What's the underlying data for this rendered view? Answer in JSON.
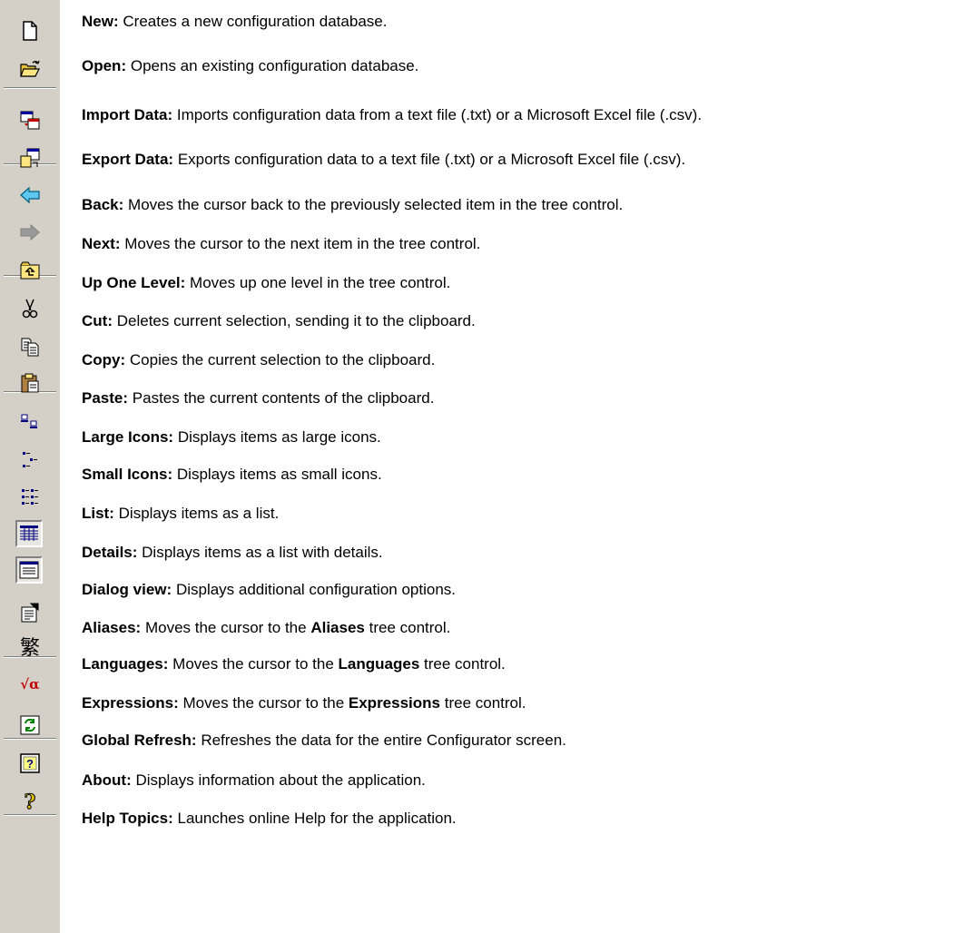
{
  "items": [
    {
      "name": "New",
      "icon": "new-document-icon",
      "desc": "Creates a new configuration database."
    },
    {
      "name": "Open",
      "icon": "open-folder-icon",
      "desc": "Opens an existing configuration database."
    },
    {
      "name": "Import Data",
      "icon": "import-data-icon",
      "desc": "Imports configuration data from a text file (.txt) or a Microsoft Excel file (.csv)."
    },
    {
      "name": "Export Data",
      "icon": "export-data-icon",
      "desc": "Exports configuration data to a text file (.txt) or a Microsoft Excel file (.csv)."
    },
    {
      "name": "Back",
      "icon": "back-arrow-icon",
      "desc": "Moves the cursor back to the previously selected item in the tree control."
    },
    {
      "name": "Next",
      "icon": "next-arrow-icon",
      "desc": "Moves the cursor to the next item in the tree control."
    },
    {
      "name": "Up One Level",
      "icon": "up-one-level-icon",
      "desc": "Moves up one level in the tree control."
    },
    {
      "name": "Cut",
      "icon": "scissors-icon",
      "desc": "Deletes current selection, sending it to the clipboard."
    },
    {
      "name": "Copy",
      "icon": "copy-icon",
      "desc": "Copies the current selection to the clipboard."
    },
    {
      "name": "Paste",
      "icon": "paste-icon",
      "desc": "Pastes the current contents of the clipboard."
    },
    {
      "name": "Large Icons",
      "icon": "large-icons-view-icon",
      "desc": "Displays items as large icons."
    },
    {
      "name": "Small Icons",
      "icon": "small-icons-view-icon",
      "desc": "Displays items as small icons."
    },
    {
      "name": "List",
      "icon": "list-view-icon",
      "desc": "Displays items as a list."
    },
    {
      "name": "Details",
      "icon": "details-view-icon",
      "desc": "Displays items as a list with details."
    },
    {
      "name": "Dialog view",
      "icon": "dialog-view-icon",
      "desc": "Displays additional configuration options."
    },
    {
      "name": "Aliases",
      "icon": "aliases-icon",
      "desc": "Moves the cursor to the",
      "bold_target": "Aliases",
      "tail": "tree control."
    },
    {
      "name": "Languages",
      "icon": "languages-icon",
      "desc": "Moves the cursor to the",
      "bold_target": "Languages",
      "tail": "tree control."
    },
    {
      "name": "Expressions",
      "icon": "expressions-icon",
      "desc": "Moves the cursor to the",
      "bold_target": "Expressions",
      "tail": "tree control."
    },
    {
      "name": "Global Refresh",
      "icon": "global-refresh-icon",
      "desc": "Refreshes the data for the entire Configurator screen."
    },
    {
      "name": "About",
      "icon": "about-icon",
      "desc": "Displays information about the application."
    },
    {
      "name": "Help Topics",
      "icon": "help-topics-icon",
      "desc": "Launches online Help for the application."
    }
  ],
  "glyphs": {
    "languages": "繁",
    "expressions": "√α",
    "about": "?",
    "help": "?"
  }
}
